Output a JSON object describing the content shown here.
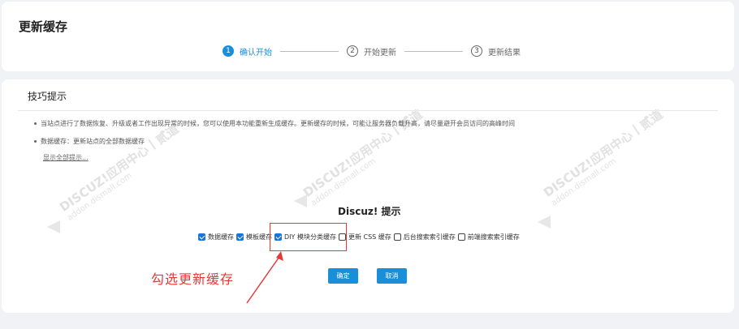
{
  "page": {
    "title": "更新缓存"
  },
  "steps": [
    {
      "num": "1",
      "label": "确认开始",
      "active": true
    },
    {
      "num": "2",
      "label": "开始更新",
      "active": false
    },
    {
      "num": "3",
      "label": "更新结果",
      "active": false
    }
  ],
  "tips": {
    "title": "技巧提示",
    "items": [
      "当站点进行了数据恢复、升级或者工作出现异常的时候，您可以使用本功能重新生成缓存。更新缓存的时候，可能让服务器负载升高，请尽量避开会员访问的高峰时间",
      "数据缓存：更新站点的全部数据缓存"
    ],
    "show_all": "显示全部提示..."
  },
  "dialog": {
    "title": "Discuz! 提示",
    "options": [
      {
        "label": "数据缓存",
        "checked": true
      },
      {
        "label": "模板缓存",
        "checked": true
      },
      {
        "label": "DIY 模块分类缓存",
        "checked": true
      },
      {
        "label": "更新 CSS 缓存",
        "checked": false
      },
      {
        "label": "后台搜索索引缓存",
        "checked": false
      },
      {
        "label": "前端搜索索引缓存",
        "checked": false
      }
    ],
    "ok_label": "确定",
    "cancel_label": "取消"
  },
  "annotation": {
    "text": "勾选更新缓存",
    "color": "#e53935"
  },
  "watermark": {
    "main": "DISCUZ!应用中心丨贰道",
    "sub": "addon.dismall.com"
  },
  "colors": {
    "accent": "#1a8fd9",
    "background": "#f0f2f5"
  }
}
